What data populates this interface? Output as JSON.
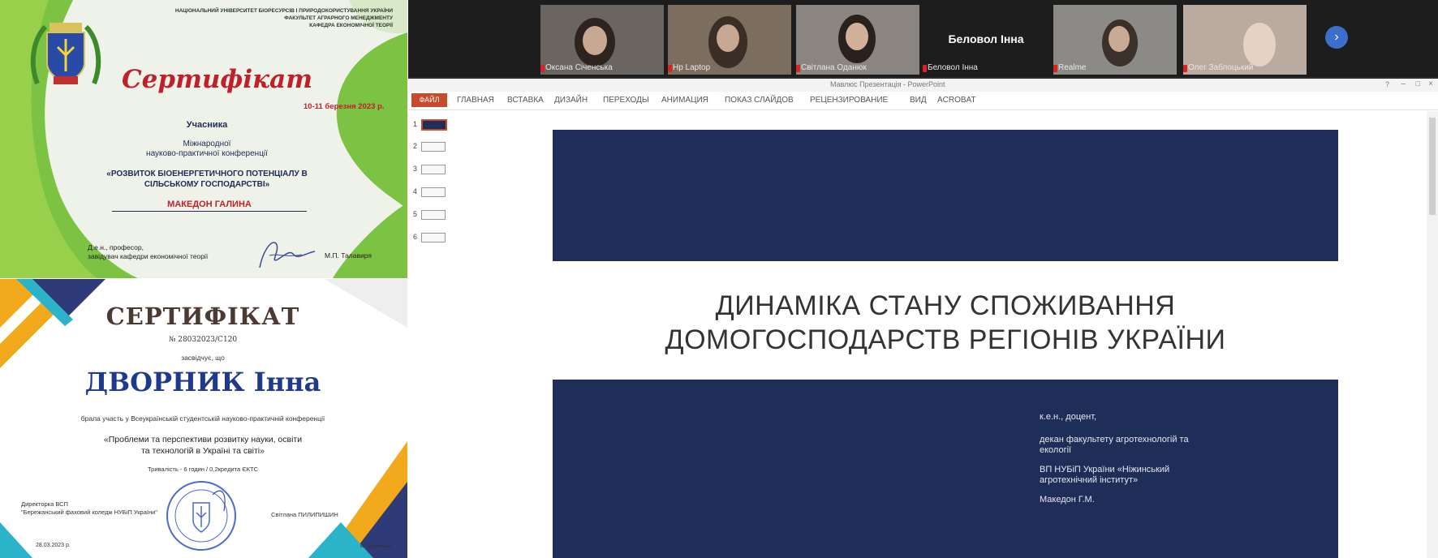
{
  "cert1": {
    "header_lines": [
      "НАЦІОНАЛЬНИЙ УНІВЕРСИТЕТ БІОРЕСУРСІВ І ПРИРОДОКОРИСТУВАННЯ УКРАЇНИ",
      "ФАКУЛЬТЕТ АГРАРНОГО МЕНЕДЖМЕНТУ",
      "КАФЕДРА ЕКОНОМІЧНОЇ ТЕОРІЇ"
    ],
    "title": "Сертифікат",
    "date": "10-11 березня 2023 р.",
    "role": "Учасника",
    "conf_line1": "Міжнародної",
    "conf_line2": "науково-практичної конференції",
    "conf_name_line1": "«РОЗВИТОК БІОЕНЕРГЕТИЧНОГО ПОТЕНЦІАЛУ В",
    "conf_name_line2": "СІЛЬСЬКОМУ ГОСПОДАРСТВІ»",
    "recipient": "МАКЕДОН ГАЛИНА",
    "signer_title_line1": "Д.е.н., професор,",
    "signer_title_line2": "завідувач кафедри економічної теорії",
    "signer_name": "М.П. Талавиря",
    "colors": {
      "green": "#7cc243",
      "red": "#c0202a",
      "navy": "#1f2a55"
    }
  },
  "cert2": {
    "title": "СЕРТИФІКАТ",
    "number": "№ 28032023/С120",
    "certifies": "засвідчує, що",
    "recipient": "ДВОРНИК Інна",
    "participated": "брала участь у Всеукраїнській студентській науково-практичній конференції",
    "conf_name_line1": "«Проблеми та перспективи розвитку науки, освіти",
    "conf_name_line2": "та технологій в Україні та світі»",
    "duration": "Тривалість - 6 годин / 0,2кредита ЄКТС",
    "director_line1": "Директорка ВСП",
    "director_line2": "\"Бережанський фаховий коледж НУБіП України\"",
    "signer_name": "Світлана ПИЛИПИШИН",
    "date": "28.03.2023 р.",
    "city": "м. Бережани",
    "colors": {
      "navy": "#1f3a8a",
      "orange": "#f2a91b",
      "teal": "#2ab3c9"
    }
  },
  "video": {
    "participants": [
      {
        "name": "Оксана Січенська"
      },
      {
        "name": "Hp Laptop"
      },
      {
        "name": "Світлана Оданюк"
      },
      {
        "name": "Беловол Інна",
        "audio_only": true
      },
      {
        "name": "Realme"
      },
      {
        "name": "Олег Заблоцький"
      }
    ],
    "center_tile_name": "Беловол Інна",
    "next_icon": "chevron-right-icon"
  },
  "ppt": {
    "window_title": "Мавлюс Презентація - PowerPoint",
    "file_tab": "ФАЙЛ",
    "tabs": [
      "ГЛАВНАЯ",
      "ВСТАВКА",
      "ДИЗАЙН",
      "ПЕРЕХОДЫ",
      "АНИМАЦИЯ",
      "ПОКАЗ СЛАЙДОВ",
      "РЕЦЕНЗИРОВАНИЕ",
      "ВИД",
      "ACROBAT"
    ],
    "thumb_numbers": [
      "1",
      "2",
      "3",
      "4",
      "5",
      "6"
    ],
    "slide_title_line1": "ДИНАМІКА СТАНУ СПОЖИВАННЯ",
    "slide_title_line2": "ДОМОГОСПОДАРСТВ РЕГІОНІВ УКРАЇНИ",
    "slide_info": [
      "к.е.н., доцент,",
      "декан факультету агротехнологій та",
      "екології",
      "ВП НУБіП України «Ніжинський",
      "агротехнічний інститут»",
      "Македон Г.М."
    ]
  }
}
